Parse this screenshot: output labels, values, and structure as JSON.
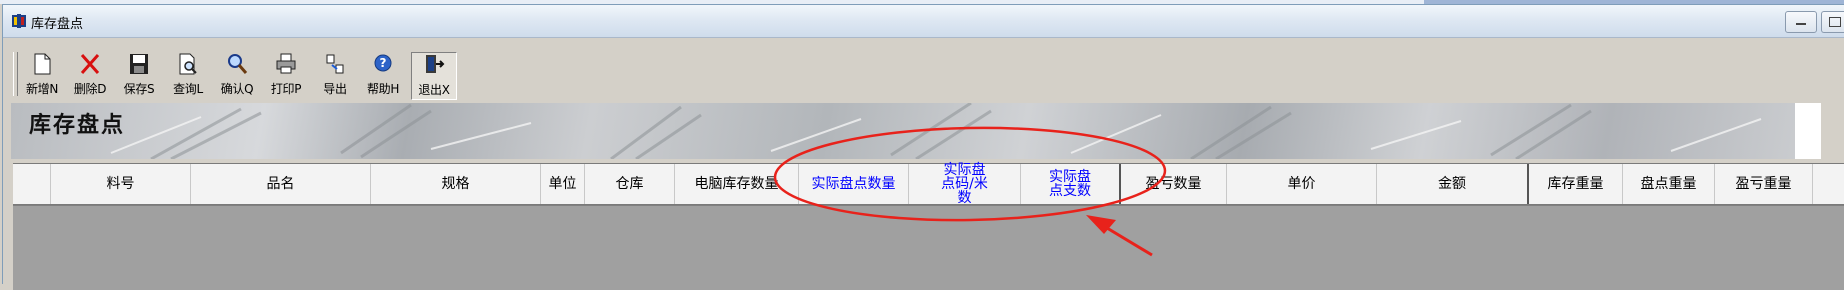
{
  "window": {
    "title": "库存盘点",
    "icon": "app-icon",
    "buttons": [
      "minimize-icon",
      "restore-icon"
    ]
  },
  "toolbar": {
    "buttons": [
      {
        "label": "新增N",
        "icon": "new-document-icon"
      },
      {
        "label": "删除D",
        "icon": "delete-x-icon"
      },
      {
        "label": "保存S",
        "icon": "floppy-disk-icon"
      },
      {
        "label": "查询L",
        "icon": "print-preview-icon"
      },
      {
        "label": "确认Q",
        "icon": "magnifier-icon"
      },
      {
        "label": "打印P",
        "icon": "printer-icon"
      },
      {
        "label": "导出",
        "icon": "export-icon"
      },
      {
        "label": "帮助H",
        "icon": "help-icon"
      },
      {
        "label": "退出X",
        "icon": "exit-door-icon"
      }
    ]
  },
  "banner": {
    "title": "库存盘点"
  },
  "grid": {
    "columns": [
      "",
      "料号",
      "品名",
      "规格",
      "单位",
      "仓库",
      "电脑库存数量",
      "实际盘点数量",
      "实际盘点码/米数",
      "实际盘点支数",
      "盈亏数量",
      "单价",
      "金额",
      "库存重量",
      "盘点重量",
      "盈亏重量"
    ],
    "rows": []
  },
  "colors": {
    "highlight_columns_text": "#0000ff",
    "annotation": "#e8221b",
    "grid_body": "#a0a0a0"
  }
}
